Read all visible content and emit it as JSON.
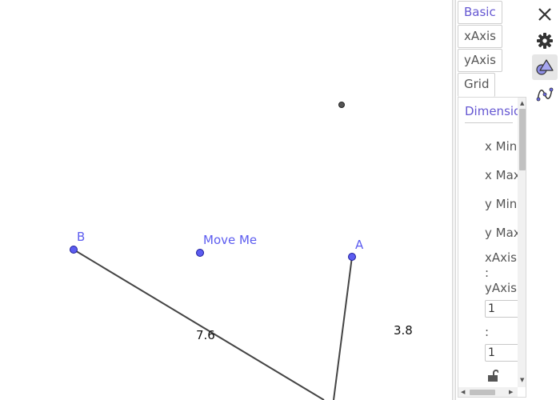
{
  "canvas": {
    "points": [
      {
        "name": "B",
        "label": "B"
      },
      {
        "name": "move-me",
        "label": "Move Me"
      },
      {
        "name": "A",
        "label": "A"
      },
      {
        "name": "free-point",
        "label": ""
      }
    ],
    "segment_lengths": [
      "7.6",
      "3.8"
    ],
    "colors": {
      "point_fill": "#5c5cf0",
      "point_stroke": "#1e1e9a",
      "label": "#5c5cf0",
      "segment": "#444444"
    }
  },
  "properties": {
    "tabs": [
      "Basic",
      "xAxis",
      "yAxis",
      "Grid"
    ],
    "active_tab": "Basic",
    "section_title": "Dimensions",
    "fields": {
      "x_min_label": "x Min:",
      "x_max_label": "x Max:",
      "y_min_label": "y Min:",
      "y_max_label": "y Max:",
      "ratio_label_1": "xAxis",
      "ratio_colon": ":",
      "ratio_label_2": "yAxis",
      "ratio_value_x": "1",
      "ratio_sep": ":",
      "ratio_value_y": "1"
    },
    "accent": "#6557d2"
  },
  "toolbar": {
    "icons": [
      "close-icon",
      "gear-icon",
      "graphics-icon",
      "algebra-graph-icon"
    ]
  }
}
